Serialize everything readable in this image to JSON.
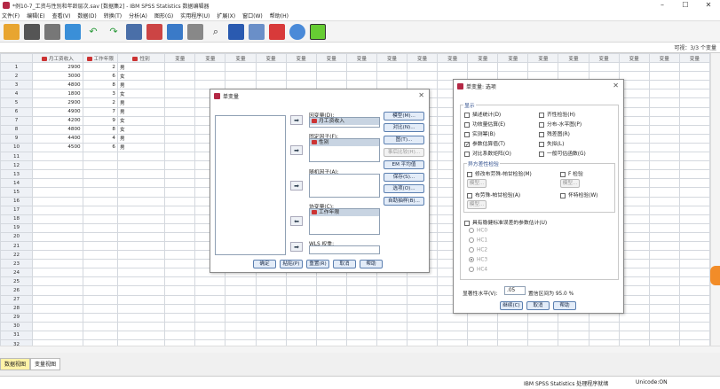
{
  "window": {
    "title": "*例10-7_工资与性别和年龄层次.sav [数据集2] - IBM SPSS Statistics 数据编辑器"
  },
  "menu": [
    "文件(F)",
    "编辑(E)",
    "查看(V)",
    "数据(D)",
    "转换(T)",
    "分析(A)",
    "图形(G)",
    "实用程序(U)",
    "扩展(X)",
    "窗口(W)",
    "帮助(H)"
  ],
  "toolbar_icons": [
    "open-icon",
    "save-icon",
    "print-icon",
    "dialog-recall-icon",
    "undo-icon",
    "redo-icon",
    "goto-case-icon",
    "goto-variable-icon",
    "variables-icon",
    "split-file-icon",
    "find-icon",
    "select-cases-icon",
    "weight-cases-icon",
    "value-labels-icon",
    "use-sets-icon",
    "spelling-icon"
  ],
  "var_count": "可视：3/3 个变量",
  "grid": {
    "columns": [
      "月工资收入",
      "工作年限",
      "性别",
      "变量",
      "变量",
      "变量",
      "变量",
      "变量",
      "变量",
      "变量",
      "变量",
      "变量",
      "变量",
      "变量",
      "变量",
      "变量",
      "变量",
      "变量",
      "变量",
      "变量",
      "变量",
      "变量"
    ],
    "rows": [
      [
        "1",
        "2900",
        "2",
        "男"
      ],
      [
        "2",
        "3000",
        "6",
        "女"
      ],
      [
        "3",
        "4800",
        "8",
        "男"
      ],
      [
        "4",
        "1800",
        "3",
        "女"
      ],
      [
        "5",
        "2900",
        "2",
        "男"
      ],
      [
        "6",
        "4900",
        "7",
        "男"
      ],
      [
        "7",
        "4200",
        "9",
        "女"
      ],
      [
        "8",
        "4800",
        "8",
        "女"
      ],
      [
        "9",
        "4400",
        "4",
        "男"
      ],
      [
        "10",
        "4500",
        "6",
        "男"
      ],
      [
        "11",
        "",
        "",
        ""
      ],
      [
        "12",
        "",
        "",
        ""
      ],
      [
        "13",
        "",
        "",
        ""
      ],
      [
        "14",
        "",
        "",
        ""
      ],
      [
        "15",
        "",
        "",
        ""
      ],
      [
        "16",
        "",
        "",
        ""
      ],
      [
        "17",
        "",
        "",
        ""
      ],
      [
        "18",
        "",
        "",
        ""
      ],
      [
        "19",
        "",
        "",
        ""
      ],
      [
        "20",
        "",
        "",
        ""
      ],
      [
        "21",
        "",
        "",
        ""
      ],
      [
        "22",
        "",
        "",
        ""
      ],
      [
        "23",
        "",
        "",
        ""
      ],
      [
        "24",
        "",
        "",
        ""
      ],
      [
        "25",
        "",
        "",
        ""
      ],
      [
        "26",
        "",
        "",
        ""
      ],
      [
        "27",
        "",
        "",
        ""
      ],
      [
        "28",
        "",
        "",
        ""
      ],
      [
        "29",
        "",
        "",
        ""
      ],
      [
        "30",
        "",
        "",
        ""
      ],
      [
        "31",
        "",
        "",
        ""
      ],
      [
        "32",
        "",
        "",
        ""
      ]
    ]
  },
  "tabs": {
    "data_view": "数据视图",
    "variable_view": "变量视图"
  },
  "status": {
    "message": "IBM SPSS Statistics 处理程序就绪",
    "unicode": "Unicode:ON"
  },
  "univariate": {
    "title": "单变量",
    "dependent_label": "因变量(D):",
    "dependent_item": "月工资收入",
    "fixed_label": "固定因子(F):",
    "fixed_item": "性别",
    "random_label": "随机因子(A):",
    "covariate_label": "协变量(C):",
    "covariate_item": "工作年限",
    "wls_label": "WLS 权重:",
    "side_buttons": [
      "模型(M)...",
      "对比(N)...",
      "图(T)...",
      "事后比较(H)...",
      "EM 平均值",
      "保存(S)...",
      "选项(O)...",
      "自助抽样(B)..."
    ],
    "bottom_buttons": [
      "确定",
      "粘贴(P)",
      "重置(R)",
      "取消",
      "帮助"
    ]
  },
  "options": {
    "title": "单变量: 选项",
    "display_label": "显示",
    "left": [
      "描述统计(D)",
      "功效量估算(E)",
      "实测幂(B)",
      "参数估算值(T)",
      "对比系数矩阵(O)"
    ],
    "left_checked": [
      false,
      false,
      false,
      true,
      false
    ],
    "right": [
      "齐性检验(H)",
      "分布-水平图(P)",
      "残差图(R)",
      "失拟(L)",
      "一般可估函数(G)"
    ],
    "hetero_label": "异方差性检验",
    "hetero_items": [
      "修改布劳殊-帕甘检验(M)",
      "F 检验",
      "模型...",
      "模型...",
      "布劳殊-帕甘检验(A)",
      "怀特检验(W)",
      "模型..."
    ],
    "robust_label": "具有稳健标准误差的参数估计(U)",
    "hc": [
      "HC0",
      "HC1",
      "HC2",
      "HC3",
      "HC4"
    ],
    "sig_label": "显著性水平(V):",
    "sig_value": ".05",
    "conf_text": "置信区间为 95.0 %",
    "buttons": [
      "继续(C)",
      "取消",
      "帮助"
    ]
  }
}
